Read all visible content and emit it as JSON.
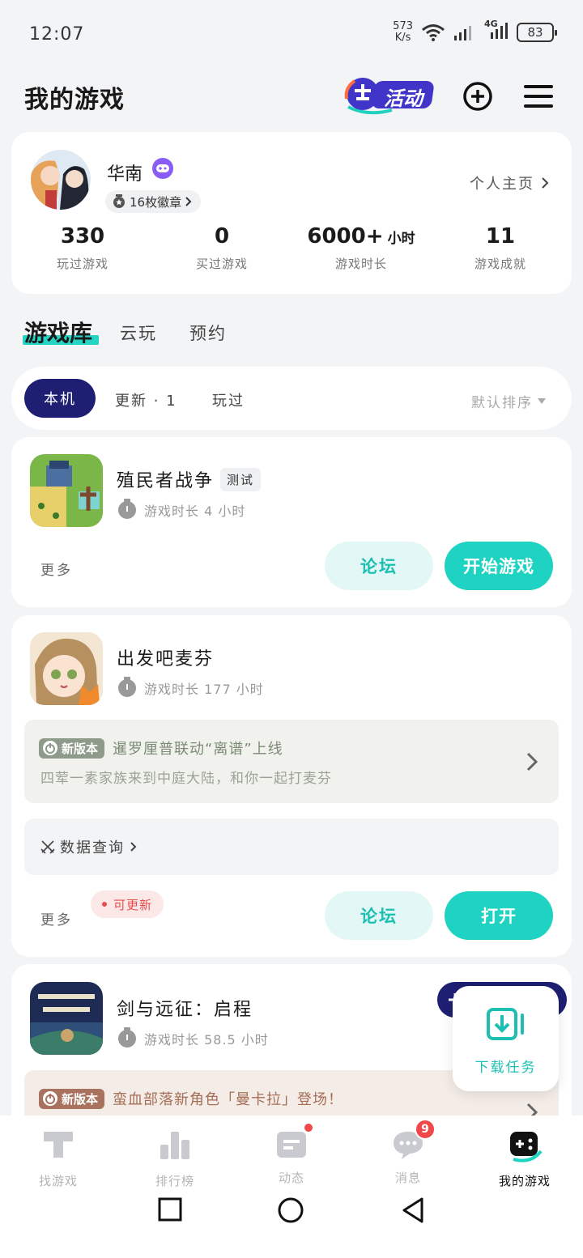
{
  "status_bar": {
    "time": "12:07",
    "net_speed_value": "573",
    "net_speed_unit": "K/s",
    "network": "4G",
    "battery": "83"
  },
  "header": {
    "title": "我的游戏",
    "activity_label": "活动",
    "add_icon": "plus-circle-icon",
    "menu_icon": "hamburger-menu-icon"
  },
  "profile": {
    "username": "华南",
    "badges_label": "16枚徽章",
    "homepage_label": "个人主页",
    "stats": [
      {
        "value": "330",
        "unit": "",
        "label": "玩过游戏"
      },
      {
        "value": "0",
        "unit": "",
        "label": "买过游戏"
      },
      {
        "value": "6000+",
        "unit": "小时",
        "label": "游戏时长"
      },
      {
        "value": "11",
        "unit": "",
        "label": "游戏成就"
      }
    ]
  },
  "tabs": {
    "active": "游戏库",
    "others": [
      "云玩",
      "预约"
    ]
  },
  "filters": {
    "local": "本机",
    "updates": "更新 · 1",
    "played": "玩过",
    "sort": "默认排序"
  },
  "games": [
    {
      "name": "殖民者战争",
      "tag": "测试",
      "playtime": "游戏时长  4  小时",
      "more": "更多",
      "forum": "论坛",
      "action": "开始游戏"
    },
    {
      "name": "出发吧麦芬",
      "playtime": "游戏时长  177  小时",
      "news_tag": "新版本",
      "news_title": "暹罗厘普联动“离谱”上线",
      "news_sub": "四荤一素家族来到中庭大陆，和你一起打麦芬",
      "data_query": "数据查询",
      "more": "更多",
      "update_tag": "可更新",
      "forum": "论坛",
      "action": "打开"
    },
    {
      "name": "剑与远征：启程",
      "playtime": "游戏时长  58.5  小时",
      "news_tag": "新版本",
      "news_title": "蛮血部落新角色「曼卡拉」登场！"
    }
  ],
  "download_float": {
    "label": "下载任务"
  },
  "bottom_nav": [
    {
      "label": "找游戏",
      "icon": "find-game-icon"
    },
    {
      "label": "排行榜",
      "icon": "ranking-icon"
    },
    {
      "label": "动态",
      "icon": "feed-icon"
    },
    {
      "label": "消息",
      "icon": "message-icon",
      "badge": "9"
    },
    {
      "label": "我的游戏",
      "icon": "my-games-icon"
    }
  ],
  "colors": {
    "accent": "#1ed3c1",
    "navy": "#1e1f72",
    "red": "#f04848"
  }
}
